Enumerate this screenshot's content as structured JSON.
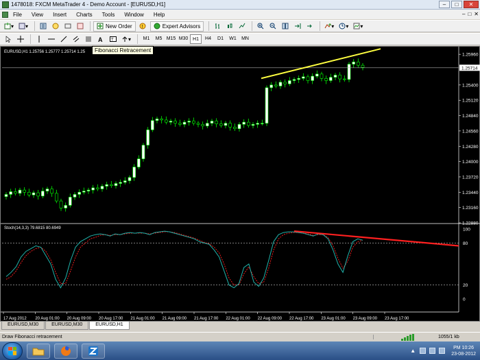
{
  "window": {
    "title": "1478018: FXCM MetaTrader 4 - Demo Account - [EURUSD,H1]",
    "min": "–",
    "max": "□",
    "close": "✕"
  },
  "menu": {
    "items": [
      "File",
      "View",
      "Insert",
      "Charts",
      "Tools",
      "Window",
      "Help"
    ],
    "mdi": [
      "–",
      "□",
      "✕"
    ]
  },
  "toolbar": {
    "new_order": "New Order",
    "expert_advisors": "Expert Advisors"
  },
  "timeframes": [
    "M1",
    "M5",
    "M15",
    "M30",
    "H1",
    "H4",
    "D1",
    "W1",
    "MN"
  ],
  "active_timeframe": "H1",
  "tooltip": "Fibonacci Retracement",
  "chart": {
    "header": "EURUSD,H1  1.25756 1.25777 1.25714 1.25",
    "stoch_header": "Stoch(14,3,3) 79.6815 80.6949",
    "current_price": "1.25714",
    "price_ticks": [
      "1.25960",
      "1.25400",
      "1.25120",
      "1.24840",
      "1.24560",
      "1.24280",
      "1.24000",
      "1.23720",
      "1.23440",
      "1.23160",
      "1.22880"
    ],
    "stoch_ticks": [
      "100",
      "80",
      "20",
      "0"
    ],
    "time_ticks": [
      "17 Aug 2012",
      "20 Aug 01:00",
      "20 Aug 09:00",
      "20 Aug 17:00",
      "21 Aug 01:00",
      "21 Aug 09:00",
      "21 Aug 17:00",
      "22 Aug 01:00",
      "22 Aug 09:00",
      "22 Aug 17:00",
      "23 Aug 01:00",
      "23 Aug 09:00",
      "23 Aug 17:00"
    ],
    "colors": {
      "bull": "#ffffff",
      "bear": "#000000",
      "wick": "#00ff00",
      "stoch_main": "#20b2aa",
      "stoch_signal": "#ff2020",
      "trendline_price": "#ffff40",
      "trendline_stoch": "#ff2020"
    }
  },
  "chart_data": {
    "type": "candlestick",
    "symbol": "EURUSD",
    "timeframe": "H1",
    "ylim": [
      1.2288,
      1.2605
    ],
    "close": [
      1.234,
      1.2345,
      1.2342,
      1.2348,
      1.2344,
      1.2339,
      1.2343,
      1.2337,
      1.2346,
      1.235,
      1.2342,
      1.2328,
      1.2315,
      1.232,
      1.2335,
      1.234,
      1.2344,
      1.2346,
      1.2348,
      1.2352,
      1.235,
      1.2355,
      1.2358,
      1.2356,
      1.236,
      1.2362,
      1.2365,
      1.2371,
      1.239,
      1.2405,
      1.243,
      1.2458,
      1.2475,
      1.2478,
      1.2476,
      1.2472,
      1.2474,
      1.247,
      1.2468,
      1.2472,
      1.2474,
      1.247,
      1.2468,
      1.2465,
      1.247,
      1.2474,
      1.2469,
      1.2466,
      1.247,
      1.2463,
      1.246,
      1.2468,
      1.2472,
      1.2466,
      1.2468,
      1.247,
      1.247,
      1.2535,
      1.254,
      1.2538,
      1.2545,
      1.2542,
      1.2548,
      1.255,
      1.2552,
      1.2555,
      1.2548,
      1.2556,
      1.256,
      1.2552,
      1.2548,
      1.2554,
      1.2558,
      1.2551,
      1.255,
      1.2578,
      1.2582,
      1.2576,
      1.2572
    ],
    "stochastic": {
      "main": [
        32,
        38,
        46,
        60,
        68,
        72,
        76,
        74,
        62,
        50,
        28,
        16,
        30,
        55,
        74,
        82,
        86,
        90,
        92,
        93,
        92,
        90,
        93,
        92,
        94,
        95,
        94,
        95,
        94,
        92,
        95,
        96,
        97,
        96,
        94,
        92,
        90,
        88,
        86,
        82,
        80,
        78,
        70,
        60,
        40,
        20,
        16,
        22,
        45,
        50,
        24,
        18,
        30,
        55,
        82,
        92,
        95,
        96,
        96,
        95,
        94,
        92,
        90,
        93,
        92,
        86,
        70,
        50,
        38,
        62,
        82,
        86,
        84
      ],
      "signal": [
        28,
        32,
        40,
        52,
        62,
        68,
        72,
        74,
        68,
        56,
        38,
        22,
        22,
        40,
        60,
        74,
        80,
        86,
        88,
        91,
        92,
        91,
        92,
        92,
        93,
        94,
        94,
        94,
        94,
        93,
        94,
        95,
        96,
        96,
        95,
        93,
        91,
        89,
        87,
        84,
        81,
        79,
        74,
        66,
        50,
        30,
        20,
        20,
        36,
        46,
        32,
        22,
        24,
        44,
        70,
        86,
        92,
        94,
        95,
        95,
        94,
        93,
        91,
        92,
        92,
        88,
        76,
        58,
        44,
        54,
        74,
        82,
        84
      ]
    },
    "price_trendline": "rising yellow line along the highs of 22–23 Aug",
    "stoch_trendline": "falling red line along the stochastic highs from 22 Aug 17:00"
  },
  "tabs": [
    {
      "label": "EURUSD,M30"
    },
    {
      "label": "EURUSD,M30"
    },
    {
      "label": "EURUSD,H1"
    }
  ],
  "active_tab": 2,
  "status": {
    "text": "Draw Fibonacci retracement",
    "traffic": "1055/1 kb"
  },
  "taskbar": {
    "clock_time": "PM 10:26",
    "clock_date": "23-08-2012",
    "tray_arrow": "▲"
  }
}
